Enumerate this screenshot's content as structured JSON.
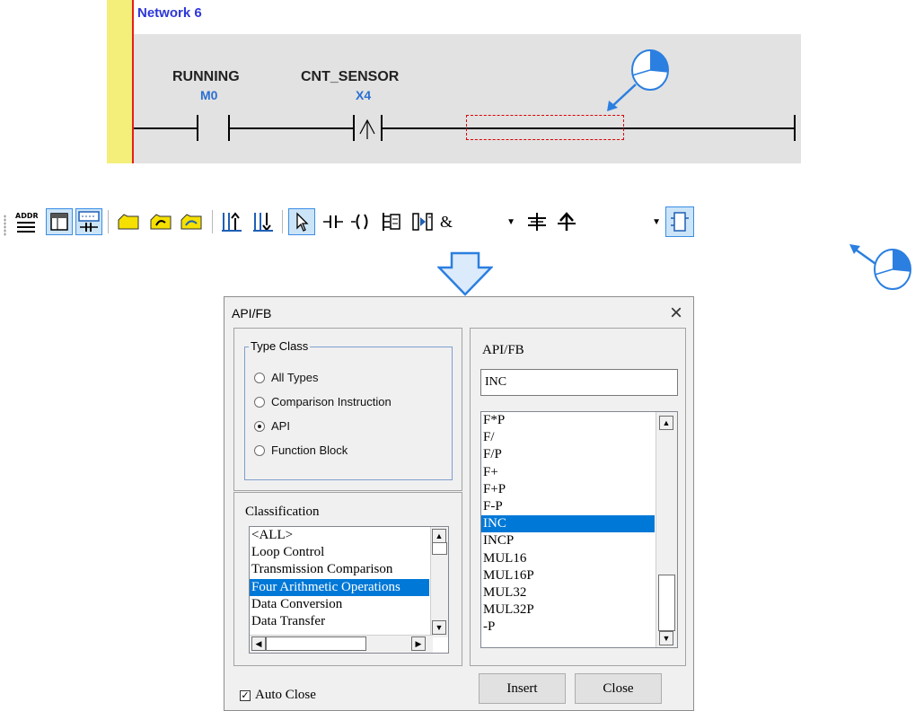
{
  "network": {
    "title": "Network 6",
    "contacts": [
      {
        "label": "RUNNING",
        "device": "M0"
      },
      {
        "label": "CNT_SENSOR",
        "device": "X4"
      }
    ]
  },
  "toolbar": {
    "buttons": [
      "addr-toggle-icon",
      "window-icon",
      "ladder-panel-icon",
      "folder-open-icon",
      "folder-mark-icon",
      "folder-mark2-icon",
      "insert-row-above-icon",
      "insert-row-below-icon",
      "pointer-icon",
      "contact-icon",
      "coil-icon",
      "ladder-block-icon",
      "branch-icon",
      "logic-dropdown",
      "connector-icon",
      "arrow-up-icon",
      "function-block-icon"
    ],
    "logic_dropdown_value": "&"
  },
  "dialog": {
    "title": "API/FB",
    "type_class": {
      "legend": "Type Class",
      "options": [
        "All Types",
        "Comparison Instruction",
        "API",
        "Function Block"
      ],
      "selected": "API"
    },
    "classification": {
      "label": "Classification",
      "items": [
        "<ALL>",
        "Loop Control",
        "Transmission Comparison",
        "Four Arithmetic Operations",
        "Data Conversion",
        "Data Transfer"
      ],
      "selected": "Four Arithmetic Operations"
    },
    "api_fb": {
      "label": "API/FB",
      "value": "INC",
      "items": [
        "F*P",
        "F/",
        "F/P",
        "F+",
        "F+P",
        "F-P",
        "INC",
        "INCP",
        "MUL16",
        "MUL16P",
        "MUL32",
        "MUL32P",
        "-P"
      ],
      "selected": "INC"
    },
    "auto_close_label": "Auto Close",
    "auto_close_checked": true,
    "insert_label": "Insert",
    "close_label": "Close"
  },
  "colors": {
    "accent": "#0078d7",
    "network_title": "#2e37d8",
    "device_label": "#2b6fd1",
    "selection_box": "#e00000",
    "pointer": "#2b7fe0"
  }
}
